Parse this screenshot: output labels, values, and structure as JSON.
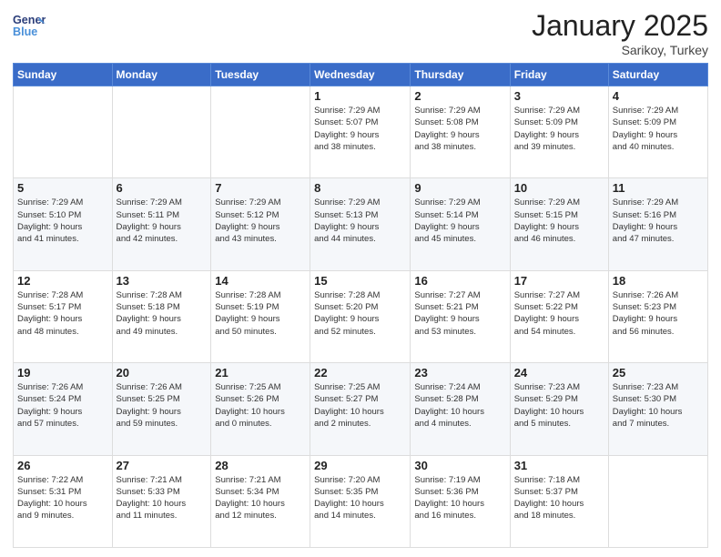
{
  "header": {
    "logo_line1": "General",
    "logo_line2": "Blue",
    "month_title": "January 2025",
    "location": "Sarikoy, Turkey"
  },
  "weekdays": [
    "Sunday",
    "Monday",
    "Tuesday",
    "Wednesday",
    "Thursday",
    "Friday",
    "Saturday"
  ],
  "weeks": [
    [
      {
        "day": "",
        "info": ""
      },
      {
        "day": "",
        "info": ""
      },
      {
        "day": "",
        "info": ""
      },
      {
        "day": "1",
        "info": "Sunrise: 7:29 AM\nSunset: 5:07 PM\nDaylight: 9 hours\nand 38 minutes."
      },
      {
        "day": "2",
        "info": "Sunrise: 7:29 AM\nSunset: 5:08 PM\nDaylight: 9 hours\nand 38 minutes."
      },
      {
        "day": "3",
        "info": "Sunrise: 7:29 AM\nSunset: 5:09 PM\nDaylight: 9 hours\nand 39 minutes."
      },
      {
        "day": "4",
        "info": "Sunrise: 7:29 AM\nSunset: 5:09 PM\nDaylight: 9 hours\nand 40 minutes."
      }
    ],
    [
      {
        "day": "5",
        "info": "Sunrise: 7:29 AM\nSunset: 5:10 PM\nDaylight: 9 hours\nand 41 minutes."
      },
      {
        "day": "6",
        "info": "Sunrise: 7:29 AM\nSunset: 5:11 PM\nDaylight: 9 hours\nand 42 minutes."
      },
      {
        "day": "7",
        "info": "Sunrise: 7:29 AM\nSunset: 5:12 PM\nDaylight: 9 hours\nand 43 minutes."
      },
      {
        "day": "8",
        "info": "Sunrise: 7:29 AM\nSunset: 5:13 PM\nDaylight: 9 hours\nand 44 minutes."
      },
      {
        "day": "9",
        "info": "Sunrise: 7:29 AM\nSunset: 5:14 PM\nDaylight: 9 hours\nand 45 minutes."
      },
      {
        "day": "10",
        "info": "Sunrise: 7:29 AM\nSunset: 5:15 PM\nDaylight: 9 hours\nand 46 minutes."
      },
      {
        "day": "11",
        "info": "Sunrise: 7:29 AM\nSunset: 5:16 PM\nDaylight: 9 hours\nand 47 minutes."
      }
    ],
    [
      {
        "day": "12",
        "info": "Sunrise: 7:28 AM\nSunset: 5:17 PM\nDaylight: 9 hours\nand 48 minutes."
      },
      {
        "day": "13",
        "info": "Sunrise: 7:28 AM\nSunset: 5:18 PM\nDaylight: 9 hours\nand 49 minutes."
      },
      {
        "day": "14",
        "info": "Sunrise: 7:28 AM\nSunset: 5:19 PM\nDaylight: 9 hours\nand 50 minutes."
      },
      {
        "day": "15",
        "info": "Sunrise: 7:28 AM\nSunset: 5:20 PM\nDaylight: 9 hours\nand 52 minutes."
      },
      {
        "day": "16",
        "info": "Sunrise: 7:27 AM\nSunset: 5:21 PM\nDaylight: 9 hours\nand 53 minutes."
      },
      {
        "day": "17",
        "info": "Sunrise: 7:27 AM\nSunset: 5:22 PM\nDaylight: 9 hours\nand 54 minutes."
      },
      {
        "day": "18",
        "info": "Sunrise: 7:26 AM\nSunset: 5:23 PM\nDaylight: 9 hours\nand 56 minutes."
      }
    ],
    [
      {
        "day": "19",
        "info": "Sunrise: 7:26 AM\nSunset: 5:24 PM\nDaylight: 9 hours\nand 57 minutes."
      },
      {
        "day": "20",
        "info": "Sunrise: 7:26 AM\nSunset: 5:25 PM\nDaylight: 9 hours\nand 59 minutes."
      },
      {
        "day": "21",
        "info": "Sunrise: 7:25 AM\nSunset: 5:26 PM\nDaylight: 10 hours\nand 0 minutes."
      },
      {
        "day": "22",
        "info": "Sunrise: 7:25 AM\nSunset: 5:27 PM\nDaylight: 10 hours\nand 2 minutes."
      },
      {
        "day": "23",
        "info": "Sunrise: 7:24 AM\nSunset: 5:28 PM\nDaylight: 10 hours\nand 4 minutes."
      },
      {
        "day": "24",
        "info": "Sunrise: 7:23 AM\nSunset: 5:29 PM\nDaylight: 10 hours\nand 5 minutes."
      },
      {
        "day": "25",
        "info": "Sunrise: 7:23 AM\nSunset: 5:30 PM\nDaylight: 10 hours\nand 7 minutes."
      }
    ],
    [
      {
        "day": "26",
        "info": "Sunrise: 7:22 AM\nSunset: 5:31 PM\nDaylight: 10 hours\nand 9 minutes."
      },
      {
        "day": "27",
        "info": "Sunrise: 7:21 AM\nSunset: 5:33 PM\nDaylight: 10 hours\nand 11 minutes."
      },
      {
        "day": "28",
        "info": "Sunrise: 7:21 AM\nSunset: 5:34 PM\nDaylight: 10 hours\nand 12 minutes."
      },
      {
        "day": "29",
        "info": "Sunrise: 7:20 AM\nSunset: 5:35 PM\nDaylight: 10 hours\nand 14 minutes."
      },
      {
        "day": "30",
        "info": "Sunrise: 7:19 AM\nSunset: 5:36 PM\nDaylight: 10 hours\nand 16 minutes."
      },
      {
        "day": "31",
        "info": "Sunrise: 7:18 AM\nSunset: 5:37 PM\nDaylight: 10 hours\nand 18 minutes."
      },
      {
        "day": "",
        "info": ""
      }
    ]
  ]
}
